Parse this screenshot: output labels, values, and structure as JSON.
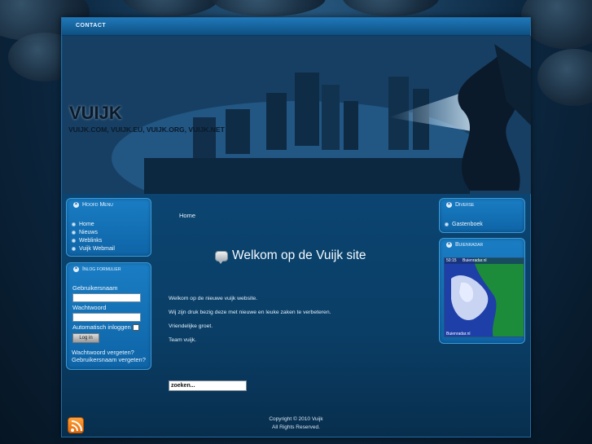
{
  "topnav": {
    "contact_label": "CONTACT"
  },
  "header": {
    "title": "VUIJK",
    "subtitle": "VUIJK.COM, VUIJK.EU, VUIJK.ORG, VUIJK.NET"
  },
  "main_menu": {
    "title": "Hoofd Menu",
    "items": [
      {
        "label": "Home"
      },
      {
        "label": "Nieuws"
      },
      {
        "label": "Weblinks"
      },
      {
        "label": "Vuijk Webmail"
      }
    ]
  },
  "login": {
    "title": "Inlog formulier",
    "username_label": "Gebruikersnaam",
    "password_label": "Wachtwoord",
    "remember_label": "Automatisch inloggen",
    "login_button": "Log in",
    "forgot_password": "Wachtwoord vergeten?",
    "forgot_username": "Gebruikersnaam vergeten?"
  },
  "breadcrumb": "Home",
  "article": {
    "title": "Welkom op de Vuijk site",
    "paragraphs": [
      "Welkom op de nieuwe vuijk website.",
      "Wij zijn druk bezig deze met nieuwe en leuke zaken te verbeteren.",
      "Vriendelijke groet.",
      "Team vuijk."
    ]
  },
  "search": {
    "value": "zoeken..."
  },
  "diverse": {
    "title": "Diverse",
    "items": [
      {
        "label": "Gastenboek"
      }
    ]
  },
  "buienradar": {
    "title": "Buienradar",
    "time_text": "50:15",
    "brand_top": "Buienradar.nl",
    "brand_bottom": "Buienradar.nl"
  },
  "footer": {
    "copyright": "Copyright © 2010 Vuijk",
    "rights": "All Rights Reserved."
  },
  "colors": {
    "accent": "#1a7dc4",
    "background": "#0c2740"
  }
}
